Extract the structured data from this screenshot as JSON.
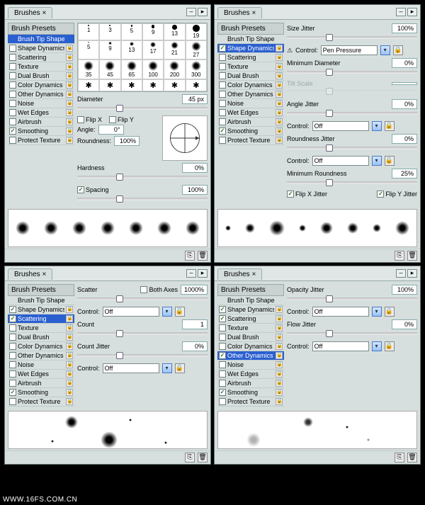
{
  "common": {
    "panel_title": "Brushes",
    "close_btn": "×",
    "min_btn": "–",
    "menu_btn": "▸",
    "dropdown_glyph": "▾",
    "sidebar_head": "Brush Presets",
    "lock_glyph": "🔒",
    "new_icon": "⎘",
    "trash_icon": "🗑"
  },
  "panels": {
    "tl": {
      "sidebar": [
        {
          "label": "Brush Tip Shape",
          "chk": null,
          "sel": true,
          "lock": false
        },
        {
          "label": "Shape Dynamics",
          "chk": false,
          "lock": true
        },
        {
          "label": "Scattering",
          "chk": false,
          "lock": true
        },
        {
          "label": "Texture",
          "chk": false,
          "lock": true
        },
        {
          "label": "Dual Brush",
          "chk": false,
          "lock": true
        },
        {
          "label": "Color Dynamics",
          "chk": false,
          "lock": true
        },
        {
          "label": "Other Dynamics",
          "chk": false,
          "lock": true
        },
        {
          "label": "Noise",
          "chk": false,
          "lock": true
        },
        {
          "label": "Wet Edges",
          "chk": false,
          "lock": true
        },
        {
          "label": "Airbrush",
          "chk": false,
          "lock": true
        },
        {
          "label": "Smoothing",
          "chk": true,
          "lock": true
        },
        {
          "label": "Protect Texture",
          "chk": false,
          "lock": true
        }
      ],
      "brush_sizes_row1": [
        1,
        3,
        5,
        9,
        13,
        19
      ],
      "brush_sizes_row2": [
        5,
        9,
        13,
        17,
        21,
        27
      ],
      "brush_sizes_row3": [
        35,
        45,
        65,
        100,
        200,
        300
      ],
      "diameter_label": "Diameter",
      "diameter_value": "45 px",
      "flipx": "Flip X",
      "flipy": "Flip Y",
      "angle_label": "Angle:",
      "angle_value": "0°",
      "roundness_label": "Roundness:",
      "roundness_value": "100%",
      "hardness_label": "Hardness",
      "hardness_value": "0%",
      "spacing_label": "Spacing",
      "spacing_value": "100%",
      "spacing_chk": true
    },
    "tr": {
      "sidebar": [
        {
          "label": "Brush Tip Shape",
          "chk": null,
          "lock": false
        },
        {
          "label": "Shape Dynamics",
          "chk": true,
          "sel": true,
          "lock": true
        },
        {
          "label": "Scattering",
          "chk": false,
          "lock": true
        },
        {
          "label": "Texture",
          "chk": false,
          "lock": true
        },
        {
          "label": "Dual Brush",
          "chk": false,
          "lock": true
        },
        {
          "label": "Color Dynamics",
          "chk": false,
          "lock": true
        },
        {
          "label": "Other Dynamics",
          "chk": false,
          "lock": true
        },
        {
          "label": "Noise",
          "chk": false,
          "lock": true
        },
        {
          "label": "Wet Edges",
          "chk": false,
          "lock": true
        },
        {
          "label": "Airbrush",
          "chk": false,
          "lock": true
        },
        {
          "label": "Smoothing",
          "chk": true,
          "lock": true
        },
        {
          "label": "Protect Texture",
          "chk": false,
          "lock": true
        }
      ],
      "size_jitter_l": "Size Jitter",
      "size_jitter_v": "100%",
      "control_l": "Control:",
      "control_icon": "⚠",
      "control_v": "Pen Pressure",
      "min_diam_l": "Minimum Diameter",
      "min_diam_v": "0%",
      "tilt_l": "Tilt Scale",
      "tilt_v": "",
      "angle_jitter_l": "Angle Jitter",
      "angle_jitter_v": "0%",
      "angle_ctrl_l": "Control:",
      "angle_ctrl_v": "Off",
      "round_jitter_l": "Roundness Jitter",
      "round_jitter_v": "0%",
      "round_ctrl_l": "Control:",
      "round_ctrl_v": "Off",
      "min_round_l": "Minimum Roundness",
      "min_round_v": "25%",
      "flipx_l": "Flip X Jitter",
      "flipx_chk": true,
      "flipy_l": "Flip Y Jitter",
      "flipy_chk": true
    },
    "bl": {
      "sidebar": [
        {
          "label": "Brush Tip Shape",
          "chk": null,
          "lock": false
        },
        {
          "label": "Shape Dynamics",
          "chk": true,
          "lock": true
        },
        {
          "label": "Scattering",
          "chk": true,
          "sel": true,
          "lock": true
        },
        {
          "label": "Texture",
          "chk": false,
          "lock": true
        },
        {
          "label": "Dual Brush",
          "chk": false,
          "lock": true
        },
        {
          "label": "Color Dynamics",
          "chk": false,
          "lock": true
        },
        {
          "label": "Other Dynamics",
          "chk": false,
          "lock": true
        },
        {
          "label": "Noise",
          "chk": false,
          "lock": true
        },
        {
          "label": "Wet Edges",
          "chk": false,
          "lock": true
        },
        {
          "label": "Airbrush",
          "chk": false,
          "lock": true
        },
        {
          "label": "Smoothing",
          "chk": true,
          "lock": true
        },
        {
          "label": "Protect Texture",
          "chk": false,
          "lock": true
        }
      ],
      "scatter_l": "Scatter",
      "both_axes_l": "Both Axes",
      "both_axes_chk": false,
      "scatter_v": "1000%",
      "ctrl1_l": "Control:",
      "ctrl1_v": "Off",
      "count_l": "Count",
      "count_v": "1",
      "count_jitter_l": "Count Jitter",
      "count_jitter_v": "0%",
      "ctrl2_l": "Control:",
      "ctrl2_v": "Off"
    },
    "br": {
      "sidebar": [
        {
          "label": "Brush Tip Shape",
          "chk": null,
          "lock": false
        },
        {
          "label": "Shape Dynamics",
          "chk": true,
          "lock": true
        },
        {
          "label": "Scattering",
          "chk": true,
          "lock": true
        },
        {
          "label": "Texture",
          "chk": false,
          "lock": true
        },
        {
          "label": "Dual Brush",
          "chk": false,
          "lock": true
        },
        {
          "label": "Color Dynamics",
          "chk": false,
          "lock": true
        },
        {
          "label": "Other Dynamics",
          "chk": true,
          "sel": true,
          "lock": true
        },
        {
          "label": "Noise",
          "chk": false,
          "lock": true
        },
        {
          "label": "Wet Edges",
          "chk": false,
          "lock": true
        },
        {
          "label": "Airbrush",
          "chk": false,
          "lock": true
        },
        {
          "label": "Smoothing",
          "chk": true,
          "lock": true
        },
        {
          "label": "Protect Texture",
          "chk": false,
          "lock": true
        }
      ],
      "opacity_l": "Opacity Jitter",
      "opacity_v": "100%",
      "ctrl1_l": "Control:",
      "ctrl1_v": "Off",
      "flow_l": "Flow Jitter",
      "flow_v": "0%",
      "ctrl2_l": "Control:",
      "ctrl2_v": "Off"
    }
  },
  "watermark": "WWW.16FS.COM.CN"
}
